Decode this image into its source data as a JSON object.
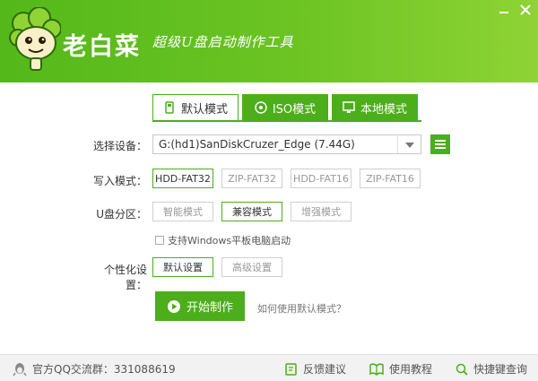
{
  "header": {
    "app_name": "老白菜",
    "slogan": "超级U盘启动制作工具",
    "minimize_icon": "minimize-icon",
    "close_icon": "close-icon"
  },
  "tabs": [
    {
      "label": "默认模式",
      "icon": "usb-drive-icon",
      "active": true
    },
    {
      "label": "ISO模式",
      "icon": "disc-icon",
      "active": false
    },
    {
      "label": "本地模式",
      "icon": "monitor-icon",
      "active": false
    }
  ],
  "device": {
    "label": "选择设备：",
    "value": "G:(hd1)SanDiskCruzer_Edge (7.44G)",
    "menu_icon": "menu-icon"
  },
  "write_mode": {
    "label": "写入模式：",
    "options": [
      "HDD-FAT32",
      "ZIP-FAT32",
      "HDD-FAT16",
      "ZIP-FAT16"
    ],
    "selected": "HDD-FAT32"
  },
  "partition": {
    "label": "U盘分区：",
    "options": [
      "智能模式",
      "兼容模式",
      "增强模式"
    ],
    "selected": "兼容模式"
  },
  "checkbox": {
    "label": "支持Windows平板电脑启动",
    "checked": false
  },
  "personalize": {
    "label": "个性化设置：",
    "options": [
      "默认设置",
      "高级设置"
    ],
    "selected": "默认设置"
  },
  "start_button": "开始制作",
  "help_link": "如何使用默认模式？",
  "footer": {
    "qq_group": "官方QQ交流群：331088619",
    "feedback": "反馈建议",
    "tutorial": "使用教程",
    "shortcut": "快捷键查询"
  },
  "colors": {
    "accent": "#4cae1a",
    "header_start": "#54b81a",
    "header_end": "#8fd335"
  }
}
